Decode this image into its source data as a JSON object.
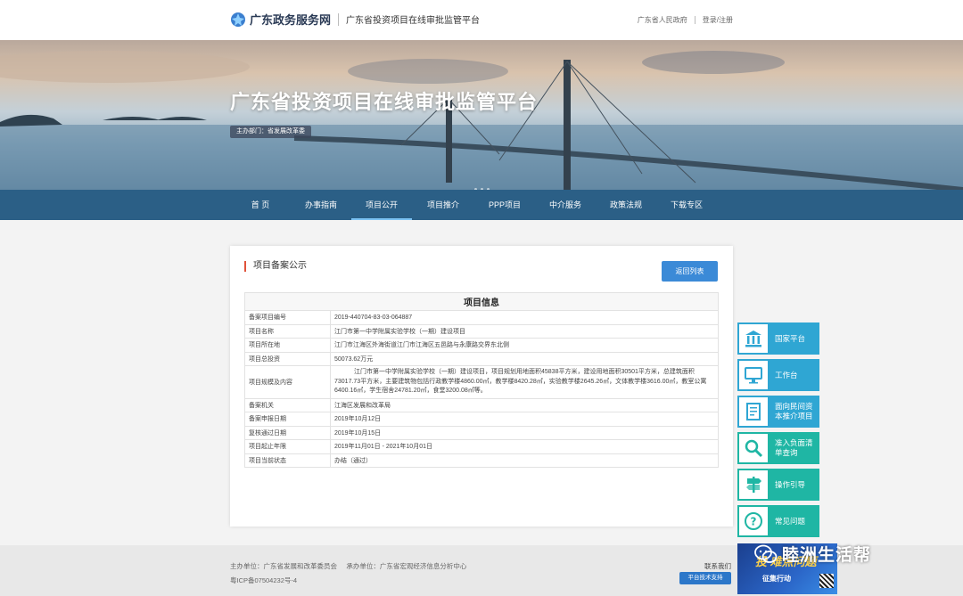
{
  "header": {
    "site_name": "广东政务服务网",
    "platform_name": "广东省投资项目在线审批监管平台",
    "gov_link": "广东省人民政府",
    "login_link": "登录/注册"
  },
  "banner": {
    "title": "广东省投资项目在线审批监管平台",
    "organizer": "主办部门：省发展改革委"
  },
  "nav": {
    "items": [
      {
        "label": "首 页"
      },
      {
        "label": "办事指南"
      },
      {
        "label": "项目公开"
      },
      {
        "label": "项目推介"
      },
      {
        "label": "PPP项目"
      },
      {
        "label": "中介服务"
      },
      {
        "label": "政策法规"
      },
      {
        "label": "下载专区"
      }
    ],
    "active_index": 2
  },
  "card": {
    "title": "项目备案公示",
    "back_button": "返回列表",
    "table_title": "项目信息",
    "rows": [
      {
        "key": "备案项目编号",
        "value": "2019-440704-83-03-064887"
      },
      {
        "key": "项目名称",
        "value": "江门市第一中学附属实验学校（一期）建设项目"
      },
      {
        "key": "项目所在地",
        "value": "江门市江海区外海街道江门市江海区五邑路与永康路交界东北侧"
      },
      {
        "key": "项目总投资",
        "value": "50073.62万元"
      },
      {
        "key": "项目规模及内容",
        "value": "江门市第一中学附属实验学校（一期）建设项目，项目规划用地面积45838平方米，建设用地面积30501平方米，总建筑面积73017.73平方米，主要建筑物包括行政教学楼4860.00㎡，教学楼8420.28㎡，实验教学楼2645.26㎡，文体教学楼3616.00㎡，教室公寓6400.16㎡，学生宿舍24781.20㎡，食堂3200.08㎡等。"
      },
      {
        "key": "备案机关",
        "value": "江海区发展和改革局"
      },
      {
        "key": "备案申报日期",
        "value": "2019年10月12日"
      },
      {
        "key": "复核通过日期",
        "value": "2019年10月15日"
      },
      {
        "key": "项目起止年限",
        "value": "2019年11月01日 - 2021年10月01日"
      },
      {
        "key": "项目当前状态",
        "value": "办结（通过）"
      }
    ]
  },
  "side": {
    "items": [
      {
        "label": "国家平台",
        "icon": "bank-icon",
        "color": "#2fa6d3"
      },
      {
        "label": "工作台",
        "icon": "monitor-icon",
        "color": "#2fa6d3"
      },
      {
        "label": "面向民间资本推介项目",
        "icon": "document-icon",
        "color": "#2fa6d3"
      },
      {
        "label": "准入负面清单查询",
        "icon": "magnifier-icon",
        "color": "#1fb6a4"
      },
      {
        "label": "操作引导",
        "icon": "signpost-icon",
        "color": "#1fb6a4"
      },
      {
        "label": "常见问题",
        "icon": "question-icon",
        "color": "#1fb6a4"
      }
    ]
  },
  "footer": {
    "organizer": "主办单位：广东省发展和改革委员会",
    "contractor": "承办单位：广东省宏观经济信息分析中心",
    "icp": "粤ICP备07504232号-4",
    "contact": "联系我们",
    "tech_support": "平台技术支持"
  },
  "promo": {
    "main": "投 难点问题",
    "sub": "征集行动"
  },
  "watermark": {
    "text": "睦洲生活帮"
  },
  "colors": {
    "nav_bg": "#2b5f86",
    "accent_blue": "#3b8ad7",
    "side_blue": "#2fa6d3",
    "side_green": "#1fb6a4",
    "title_bar_red": "#e0523a"
  }
}
